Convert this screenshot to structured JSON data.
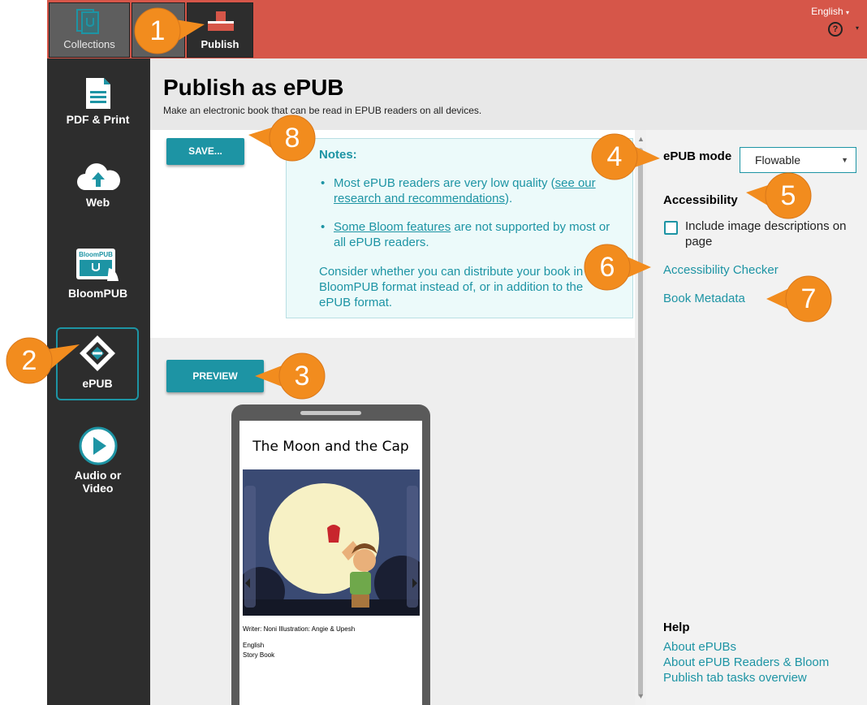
{
  "topbar": {
    "tabs": [
      {
        "label": "Collections",
        "icon": "collections-icon"
      },
      {
        "label": "Publish",
        "icon": "publish-icon"
      }
    ],
    "language": "English",
    "help_glyph": "?",
    "colors": {
      "bar": "#d65649",
      "tab_inactive": "#5e5e5e",
      "tab_active": "#2d2d2d"
    }
  },
  "sidebar": {
    "items": [
      {
        "label": "PDF & Print",
        "icon": "pdf-document-icon"
      },
      {
        "label": "Web",
        "icon": "cloud-upload-icon"
      },
      {
        "label": "BloomPUB",
        "icon": "bloompub-device-icon",
        "icon_text": "BloomPUB"
      },
      {
        "label": "ePUB",
        "icon": "epub-icon",
        "selected": true
      },
      {
        "label": "Audio or Video",
        "icon": "play-icon"
      }
    ]
  },
  "header": {
    "title": "Publish as ePUB",
    "subtitle": "Make an electronic book that can be read in EPUB readers on all devices."
  },
  "buttons": {
    "save": "SAVE...",
    "preview": "PREVIEW"
  },
  "notes": {
    "title": "Notes:",
    "item1_text": "Most ePUB readers are very low quality (",
    "item1_link": "see our research and recommendations",
    "item1_end": ").",
    "item2_link": "Some Bloom features",
    "item2_text": " are not supported by most or all ePUB readers.",
    "paragraph": "Consider whether you can distribute your book in the BloomPUB format instead of, or in addition to the ePUB format."
  },
  "settings": {
    "mode_label": "ePUB mode",
    "mode_value": "Flowable",
    "accessibility_title": "Accessibility",
    "include_descriptions": "Include image descriptions on page",
    "include_descriptions_checked": false,
    "accessibility_checker": "Accessibility Checker",
    "book_metadata": "Book Metadata"
  },
  "help": {
    "title": "Help",
    "links": [
      "About ePUBs",
      "About ePUB Readers & Bloom",
      "Publish tab tasks overview"
    ]
  },
  "preview": {
    "book_title": "The Moon and the Cap",
    "credits": "Writer: Noni Illustration: Angie & Upesh",
    "language": "English",
    "type": "Story Book"
  },
  "callouts": [
    "1",
    "2",
    "3",
    "4",
    "5",
    "6",
    "7",
    "8"
  ],
  "colors": {
    "accent": "#1d94a4",
    "callout": "#f28c1e",
    "notes_bg": "#ecfafa"
  }
}
